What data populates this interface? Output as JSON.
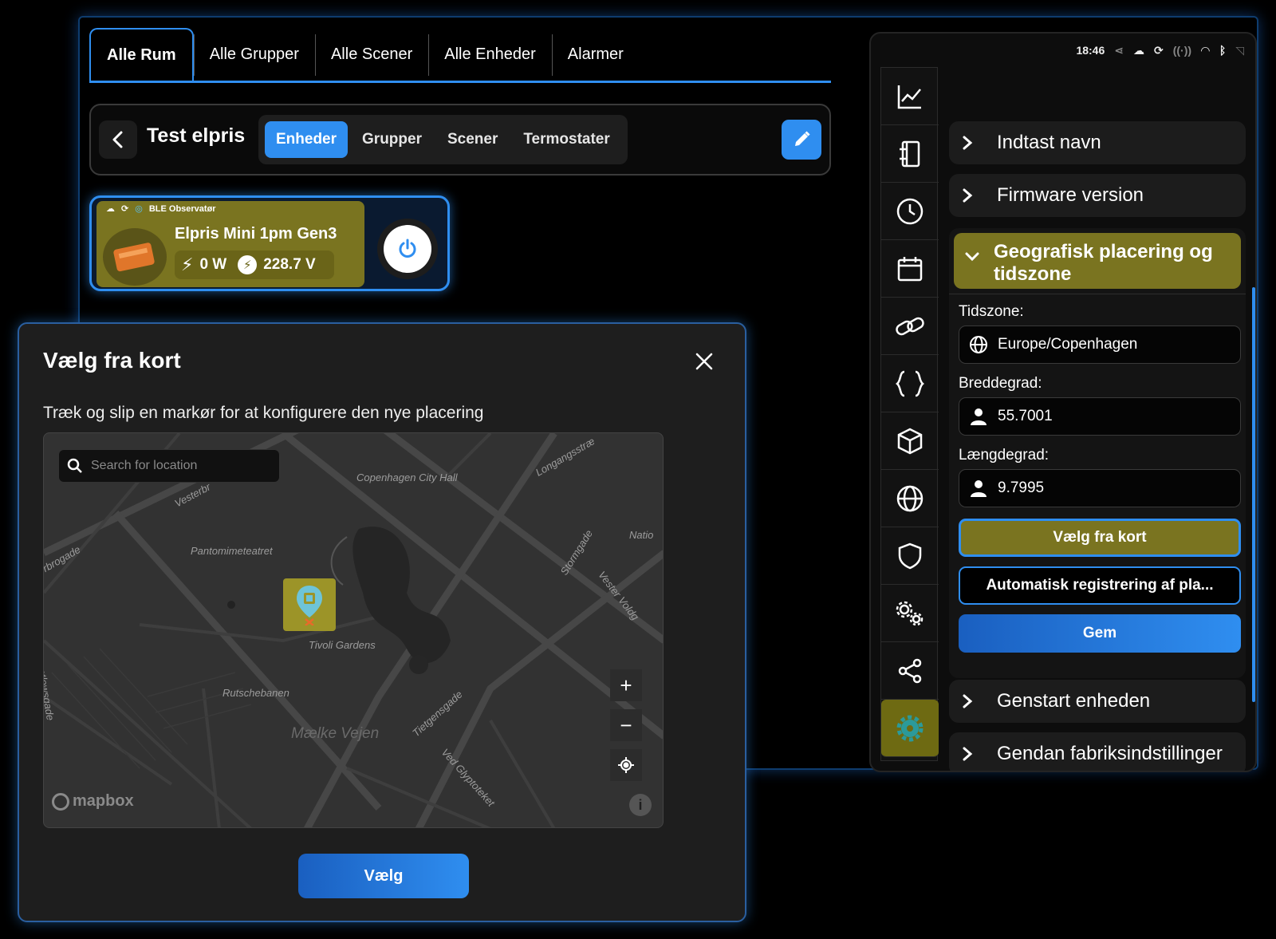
{
  "tabs": [
    "Alle Rum",
    "Alle Grupper",
    "Alle Scener",
    "Alle Enheder",
    "Alarmer"
  ],
  "room": {
    "title": "Test elpris",
    "subtabs": [
      "Enheder",
      "Grupper",
      "Scener",
      "Termostater"
    ]
  },
  "device": {
    "status": "BLE Observatør",
    "name": "Elpris Mini 1pm Gen3",
    "power": "0 W",
    "voltage": "228.7 V"
  },
  "settings": {
    "time": "18:46",
    "sections": {
      "name": "Indtast navn",
      "firmware": "Firmware version",
      "geo_line1": "Geografisk placering og",
      "geo_line2": "tidszone",
      "restart": "Genstart enheden",
      "factory": "Gendan fabriksindstillinger"
    },
    "timezone_label": "Tidszone:",
    "timezone_value": "Europe/Copenhagen",
    "lat_label": "Breddegrad:",
    "lat_value": "55.7001",
    "lon_label": "Længdegrad:",
    "lon_value": "9.7995",
    "pick_map_button": "Vælg fra kort",
    "auto_button": "Automatisk registrering af pla...",
    "save_button": "Gem"
  },
  "modal": {
    "title": "Vælg fra kort",
    "description": "Træk og slip en markør for at konfigurere den nye placering",
    "search_placeholder": "Search for location",
    "map_labels": {
      "city_hall": "Copenhagen City Hall",
      "vesterbro": "Vesterbr",
      "longangstr": "Longangsstræ",
      "rbrogade": "rbrogade",
      "pantomime": "Pantomimeteatret",
      "natio": "Natio",
      "stormgade": "Stormgade",
      "vester_volde": "Vester Voldg",
      "tivoli": "Tivoli Gardens",
      "lowsgade": "ntlowsgade",
      "rutsche": "Rutschebanen",
      "maelke": "Mælke Vejen",
      "tietgen": "Tietgensgade",
      "glypto": "Ved Glyptoteket"
    },
    "attribution": "mapbox",
    "confirm_button": "Vælg"
  },
  "colors": {
    "accent": "#2f8ef0",
    "olive": "#7a7420"
  }
}
